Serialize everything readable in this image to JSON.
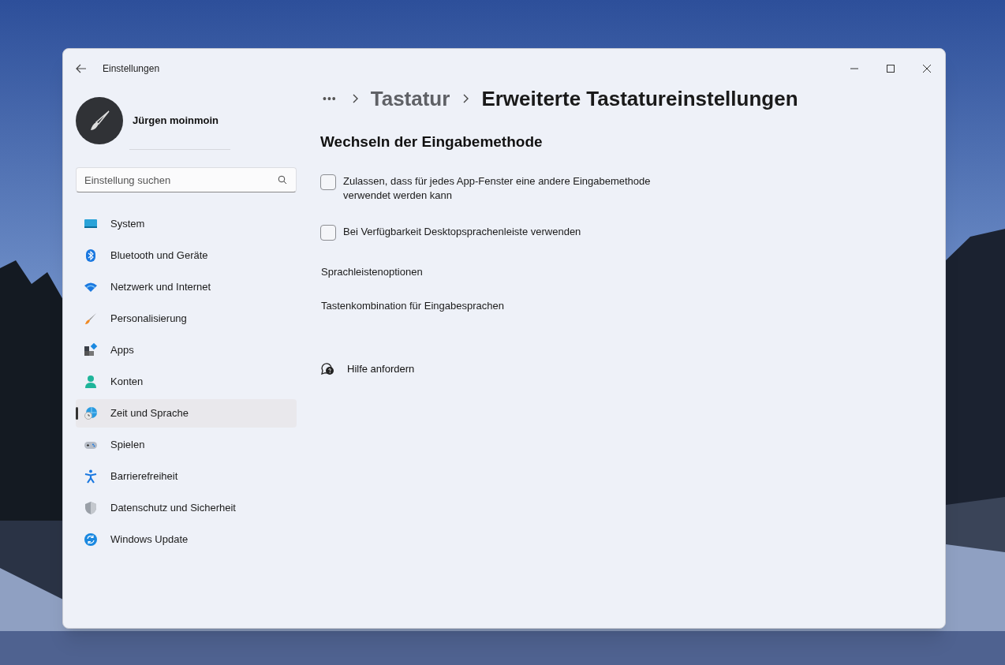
{
  "window": {
    "title": "Einstellungen"
  },
  "account": {
    "name": "Jürgen moinmoin"
  },
  "search": {
    "placeholder": "Einstellung suchen"
  },
  "sidebar": {
    "items": [
      {
        "label": "System",
        "selected": false
      },
      {
        "label": "Bluetooth und Geräte",
        "selected": false
      },
      {
        "label": "Netzwerk und Internet",
        "selected": false
      },
      {
        "label": "Personalisierung",
        "selected": false
      },
      {
        "label": "Apps",
        "selected": false
      },
      {
        "label": "Konten",
        "selected": false
      },
      {
        "label": "Zeit und Sprache",
        "selected": true
      },
      {
        "label": "Spielen",
        "selected": false
      },
      {
        "label": "Barrierefreiheit",
        "selected": false
      },
      {
        "label": "Datenschutz und Sicherheit",
        "selected": false
      },
      {
        "label": "Windows Update",
        "selected": false
      }
    ]
  },
  "breadcrumb": {
    "ellipsis": "•••",
    "items": [
      "Tastatur",
      "Erweiterte Tastatureinstellungen"
    ]
  },
  "section": {
    "title": "Wechseln der Eingabemethode"
  },
  "options": [
    {
      "label": "Zulassen, dass für jedes App-Fenster eine andere Eingabemethode verwendet werden kann",
      "checked": false
    },
    {
      "label": "Bei Verfügbarkeit Desktopsprachenleiste verwenden",
      "checked": false
    }
  ],
  "links": [
    "Sprachleistenoptionen",
    "Tastenkombination für Eingabesprachen"
  ],
  "help": {
    "label": "Hilfe anfordern"
  }
}
